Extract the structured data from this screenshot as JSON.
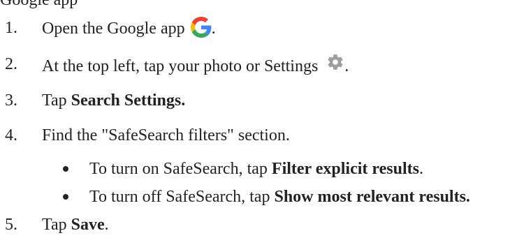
{
  "intro_partial": "Google app",
  "steps": [
    {
      "num": "1.",
      "text_before": "Open the Google app",
      "text_after": "."
    },
    {
      "num": "2.",
      "text_before": "At the top left, tap your photo or Settings",
      "text_after": "."
    },
    {
      "num": "3.",
      "text_plain": "Tap ",
      "text_bold": "Search Settings."
    },
    {
      "num": "4.",
      "text": "Find the \"SafeSearch filters\" section."
    },
    {
      "num": "5.",
      "text_plain": "Tap ",
      "text_bold": "Save",
      "text_after": "."
    }
  ],
  "bullets": [
    {
      "text_plain": "To turn on SafeSearch, tap ",
      "text_bold": "Filter explicit results",
      "text_after": "."
    },
    {
      "text_plain": "To turn off SafeSearch, tap ",
      "text_bold": "Show most relevant results."
    }
  ],
  "icons": {
    "google": "google-g-logo",
    "settings": "gear-icon"
  },
  "colors": {
    "text": "#222222",
    "google_blue": "#4285F4",
    "google_red": "#EA4335",
    "google_yellow": "#FBBC05",
    "google_green": "#34A853",
    "gear": "#9e9e9e"
  }
}
